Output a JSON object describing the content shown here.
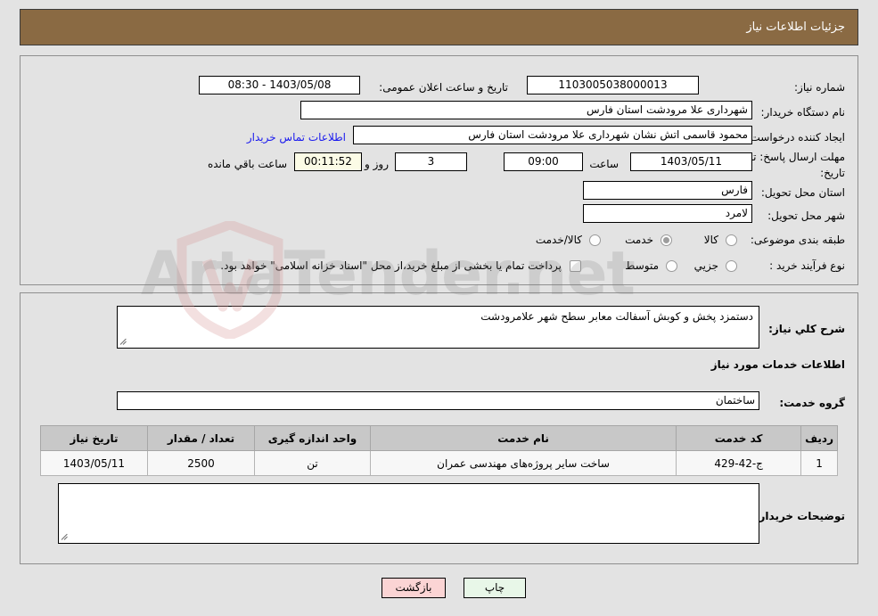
{
  "header": {
    "title": "جزئیات اطلاعات نیاز",
    "bg_color": "#8a6a43",
    "text_color": "#ffffff"
  },
  "watermark": {
    "text": "ArtaTender.net",
    "shield_color": "#d99a9a"
  },
  "top_panel": {
    "need_number": {
      "label": "شماره نیاز:",
      "value": "1103005038000013"
    },
    "public_announce": {
      "label": "تاریخ و ساعت اعلان عمومی:",
      "value": "1403/05/08 - 08:30"
    },
    "buyer_org": {
      "label": "نام دستگاه خریدار:",
      "value": "شهرداری علا مرودشت استان فارس"
    },
    "requester": {
      "label": "ایجاد کننده درخواست:",
      "value": "محمود قاسمی اتش نشان شهرداری علا مرودشت استان فارس"
    },
    "contact_link": {
      "label": "اطلاعات تماس خریدار",
      "color": "#1a1aee"
    },
    "deadline": {
      "label_line1": "مهلت ارسال پاسخ: تا",
      "label_line2": "تاریخ:",
      "date": "1403/05/11",
      "hour_label": "ساعت",
      "hour_value": "09:00",
      "days_value": "3",
      "days_label": "روز و",
      "countdown": "00:11:52",
      "countdown_label": "ساعت باقي مانده"
    },
    "delivery_province": {
      "label": "استان محل تحویل:",
      "value": "فارس"
    },
    "delivery_city": {
      "label": "شهر محل تحویل:",
      "value": "لامرد"
    },
    "subject_class": {
      "label": "طبقه بندی موضوعی:",
      "options": [
        {
          "label": "کالا",
          "selected": false
        },
        {
          "label": "خدمت",
          "selected": true
        },
        {
          "label": "کالا/خدمت",
          "selected": false
        }
      ]
    },
    "purchase_process": {
      "label": "نوع فرآیند خرید :",
      "options": [
        {
          "label": "جزیي",
          "selected": false
        },
        {
          "label": "متوسط",
          "selected": false
        }
      ],
      "treasury_checkbox": {
        "checked": false,
        "label": "پرداخت تمام یا بخشی از مبلغ خرید،از محل \"اسناد خزانه اسلامی\" خواهد بود."
      }
    }
  },
  "bottom_panel": {
    "general_desc": {
      "label": "شرح کلي نیاز:",
      "value": "دستمزد پخش و کوبش آسفالت معابر سطح شهر علامرودشت"
    },
    "services_heading": "اطلاعات خدمات مورد نیاز",
    "service_group": {
      "label": "گروه خدمت:",
      "value": "ساختمان"
    },
    "table": {
      "columns": [
        "ردیف",
        "کد خدمت",
        "نام خدمت",
        "واحد اندازه گیری",
        "تعداد / مقدار",
        "تاریخ نیاز"
      ],
      "rows": [
        {
          "row": "1",
          "code": "ج-42-429",
          "name": "ساخت سایر پروژه‌های مهندسی عمران",
          "unit": "تن",
          "quantity": "2500",
          "need_date": "1403/05/11"
        }
      ]
    },
    "buyer_comments": {
      "label": "توضیحات خریدار:",
      "value": ""
    }
  },
  "footer": {
    "print_button": "چاپ",
    "back_button": "بازگشت"
  }
}
